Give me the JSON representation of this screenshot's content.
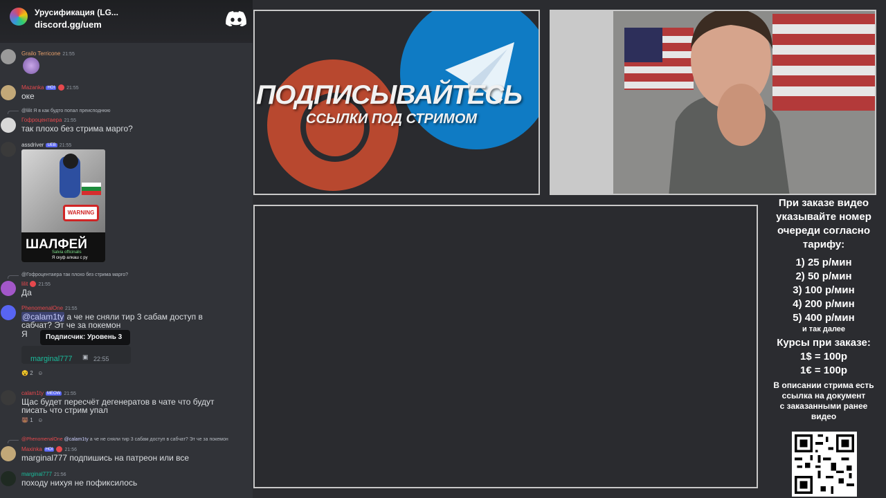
{
  "server": {
    "name": "Урусификация (LG...",
    "invite": "discord.gg/uem"
  },
  "messages": [
    {
      "user": "Grailo Terricone",
      "time": "21:55",
      "color": "#e8a06b"
    },
    {
      "user": "Mazanka",
      "badge": "HOI",
      "time": "21:55",
      "text": "оке",
      "color": "#e5484d"
    },
    {
      "reply": "@lilit Я в как будто попал преисподнюю",
      "user": "Гофроцентаера",
      "time": "21:55",
      "text": "так плохо без стрима марго?",
      "color": "#e5484d"
    },
    {
      "user": "assdriver",
      "badge": "UEB",
      "time": "21:55",
      "color": "#dbdee1"
    },
    {
      "reply": "@Гофроцентаера так плохо без стрима марго?",
      "user": "lilit",
      "time": "21:55",
      "text": "Да",
      "color": "#e5484d"
    },
    {
      "user": "PhenomenalOne",
      "time": "21:55",
      "text_line1": "а че не сняли тир 3 сабам доступ в",
      "text_line2": "сабчат? Эт че за покемон",
      "mention": "@calam1ty",
      "extra": "Я",
      "color": "#e5484d"
    },
    {
      "user": "calam1ty",
      "badge": "MEOW",
      "time": "21:55",
      "text_line1": "Щас будет пересчёт дегенератов в чате что будут",
      "text_line2": "писать что стрим упал",
      "color": "#e5484d"
    },
    {
      "reply_user": "@PhenomenalOne",
      "reply_mention": "@calam1ty",
      "reply": "а че не сняли тир 3 сабам доступ в сабчат? Эт че за покемон",
      "user": "Maxinka",
      "badge": "HOI",
      "time": "21:56",
      "text": "marginal777 подпишись на патреон или все",
      "color": "#e5484d"
    },
    {
      "user": "marginal777",
      "time": "21:56",
      "text": "походу нихуя не пофиксилось",
      "color": "#1abc9c"
    }
  ],
  "reactions": {
    "r1_count": "2",
    "r2_count": "1"
  },
  "image": {
    "warning": "WARNING",
    "caption": "ШАЛФЕЙ",
    "latin": "Salvia officinalis",
    "sub": "Я скуф алкаш с ру"
  },
  "tooltip": "Подписчик: Уровень 3",
  "embed": {
    "name": "marginal777",
    "time": "22:55"
  },
  "banner": {
    "title": "ПОДПИСЫВАЙТЕСЬ",
    "subtitle": "ССЫЛКИ ПОД СТРИМОМ"
  },
  "info": {
    "header": [
      "При заказе видео",
      "указывайте номер",
      "очереди согласно",
      "тарифу:"
    ],
    "tariffs": [
      "1) 25 р/мин",
      "2) 50 р/мин",
      "3) 100 р/мин",
      "4) 200 р/мин",
      "5) 400 р/мин"
    ],
    "etc": "и так далее",
    "courses_title": "Курсы при заказе:",
    "courses": [
      "1$ = 100р",
      "1€ = 100р"
    ],
    "note": [
      "В описании стрима есть",
      "ссылка на документ",
      "с заказанными ранее",
      "видео"
    ]
  }
}
